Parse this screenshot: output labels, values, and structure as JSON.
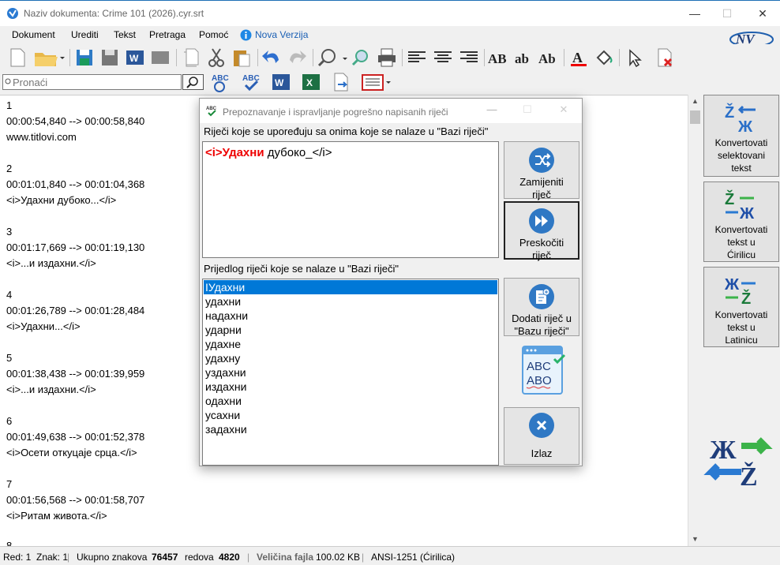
{
  "window": {
    "title": "Naziv dokumenta: Crime 101 (2026).cyr.srt",
    "min": "—",
    "max": "☐",
    "close": "✕"
  },
  "menu": [
    "Dokument",
    "Urediti",
    "Tekst",
    "Pretraga",
    "Pomoć",
    "Nova Verzija"
  ],
  "logo_text": "NV",
  "search": {
    "placeholder": "Pronaći"
  },
  "editor_lines": [
    "1",
    "00:00:54,840 --> 00:00:58,840",
    "www.titlovi.com",
    "",
    "2",
    "00:01:01,840 --> 00:01:04,368",
    "<i>Удахни дубоко...</i>",
    "",
    "3",
    "00:01:17,669 --> 00:01:19,130",
    "<i>...и издахни.</i>",
    "",
    "4",
    "00:01:26,789 --> 00:01:28,484",
    "<i>Удахни...</i>",
    "",
    "5",
    "00:01:38,438 --> 00:01:39,959",
    "<i>...и издахни.</i>",
    "",
    "6",
    "00:01:49,638 --> 00:01:52,378",
    "<i>Осети откуцаје срца.</i>",
    "",
    "7",
    "00:01:56,568 --> 00:01:58,707",
    "<i>Ритам живота.</i>",
    "",
    "8"
  ],
  "right_panel": {
    "btn1": [
      "Konvertovati",
      "selektovani",
      "tekst"
    ],
    "btn2": [
      "Konvertovati",
      "tekst u",
      "Ćirilicu"
    ],
    "btn3": [
      "Konvertovati",
      "tekst u",
      "Latinicu"
    ]
  },
  "status": {
    "red_label": "Red: 1",
    "znak_label": "Znak: 1",
    "ukupno_label": "Ukupno znakova",
    "ukupno_value": "76457",
    "redova_label": "redova",
    "redova_value": "4820",
    "velicina_label": "Veličina fajla",
    "velicina_value": "100.02 KB",
    "encoding": "ANSI-1251 (Ćirilica)"
  },
  "dialog": {
    "title": "Prepoznavanje i ispravljanje pogrešno napisanih riječi",
    "label_compare": "Riječi koje se upoređuju sa onima koje se nalaze u \"Bazi riječi\"",
    "word_highlight": "<i>Удахни",
    "word_rest": " дубоко_</i>",
    "label_suggest": "Prijedlog riječi koje se nalaze u \"Bazi riječi\"",
    "suggestions": [
      "IУдахни",
      "удахни",
      "надахни",
      "ударни",
      "удахне",
      "удахну",
      "уздахни",
      "издахни",
      "одахни",
      "усахни",
      "задахни"
    ],
    "btn_replace": [
      "Zamijeniti",
      "riječ"
    ],
    "btn_skip": [
      "Preskočiti",
      "riječ"
    ],
    "btn_add": [
      "Dodati riječ u",
      "\"Bazu riječi\""
    ],
    "spell_abc": "ABC",
    "spell_abo": "ABO",
    "btn_exit": "Izlaz"
  },
  "colors": {
    "accent": "#0078d7",
    "highlight_red": "#e00000",
    "icon_blue": "#2f78c4"
  }
}
